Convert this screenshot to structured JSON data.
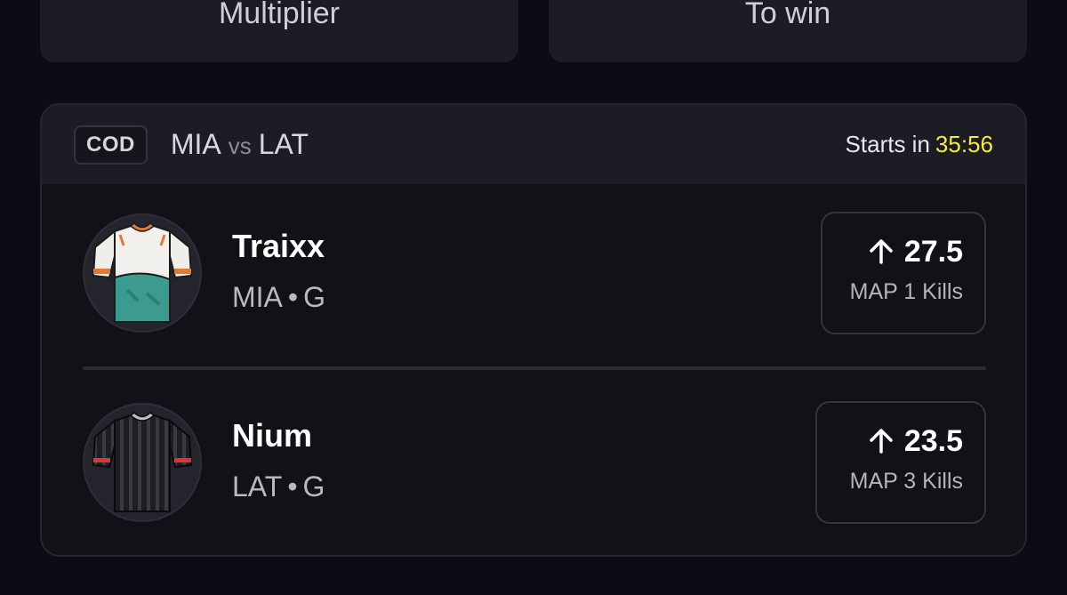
{
  "summary": {
    "multiplier_label": "Multiplier",
    "to_win_label": "To win"
  },
  "match": {
    "league": "COD",
    "home_team": "MIA",
    "vs": "vs",
    "away_team": "LAT",
    "starts_label": "Starts in",
    "starts_time": "35:56",
    "starts_time_color": "#f3e84a"
  },
  "players": [
    {
      "name": "Traixx",
      "team": "MIA",
      "position": "G",
      "separator": "•",
      "jersey_icon": "jersey-white-teal-icon",
      "line_value": "27.5",
      "direction_icon": "arrow-up-icon",
      "stat_label": "MAP 1 Kills"
    },
    {
      "name": "Nium",
      "team": "LAT",
      "position": "G",
      "separator": "•",
      "jersey_icon": "jersey-black-striped-icon",
      "line_value": "23.5",
      "direction_icon": "arrow-up-icon",
      "stat_label": "MAP 3 Kills"
    }
  ]
}
